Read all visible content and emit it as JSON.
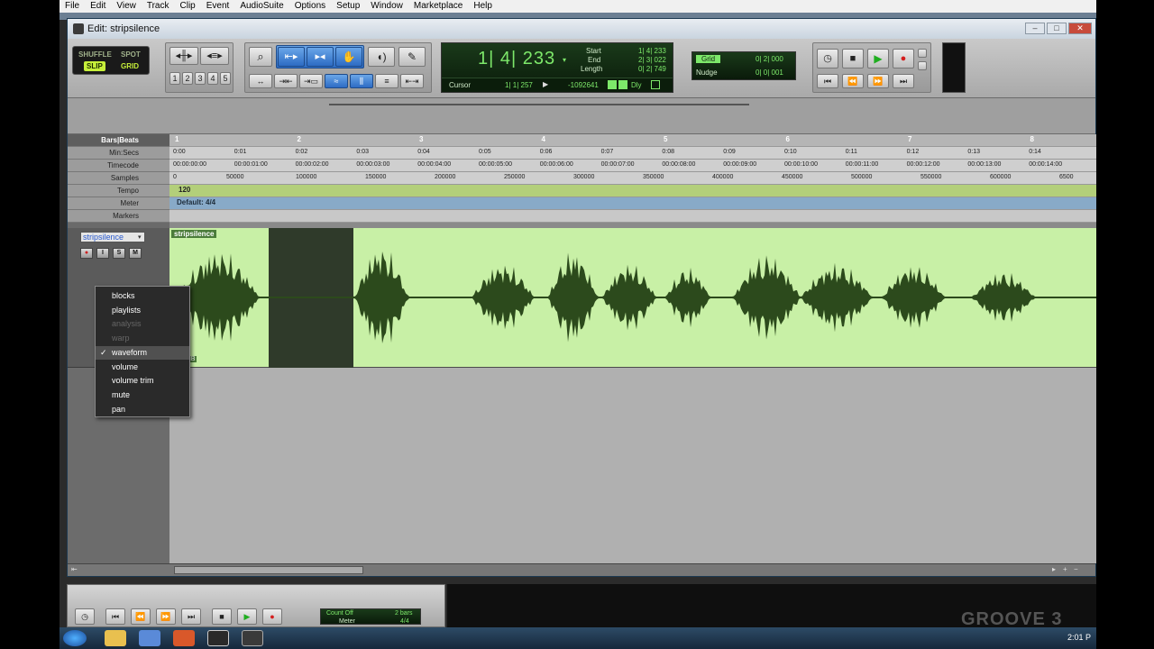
{
  "menu": [
    "File",
    "Edit",
    "View",
    "Track",
    "Clip",
    "Event",
    "AudioSuite",
    "Options",
    "Setup",
    "Window",
    "Marketplace",
    "Help"
  ],
  "window": {
    "title": "Edit: stripsilence"
  },
  "modes": {
    "shuffle": "SHUFFLE",
    "spot": "SPOT",
    "slip": "SLIP",
    "grid": "GRID"
  },
  "zoom_presets": [
    "1",
    "2",
    "3",
    "4",
    "5"
  ],
  "counter": {
    "main": "1| 4| 233",
    "start_label": "Start",
    "start": "1| 4| 233",
    "end_label": "End",
    "end": "2| 3| 022",
    "length_label": "Length",
    "length": "0| 2| 749",
    "cursor_label": "Cursor",
    "cursor": "1| 1| 257",
    "sample": "-1092641",
    "dly": "Dly"
  },
  "grid": {
    "label": "Grid",
    "value": "0| 2| 000",
    "nudge_label": "Nudge",
    "nudge": "0| 0| 001"
  },
  "rulers": {
    "labels": [
      "Bars|Beats",
      "Min:Secs",
      "Timecode",
      "Samples",
      "Tempo",
      "Meter",
      "Markers"
    ],
    "bars": [
      "1",
      "2",
      "3",
      "4",
      "5",
      "6",
      "7",
      "8"
    ],
    "minsecs": [
      "0:00",
      "0:01",
      "0:02",
      "0:03",
      "0:04",
      "0:05",
      "0:06",
      "0:07",
      "0:08",
      "0:09",
      "0:10",
      "0:11",
      "0:12",
      "0:13",
      "0:14"
    ],
    "timecode": [
      "00:00:00:00",
      "00:00:01:00",
      "00:00:02:00",
      "00:00:03:00",
      "00:00:04:00",
      "00:00:05:00",
      "00:00:06:00",
      "00:00:07:00",
      "00:00:08:00",
      "00:00:09:00",
      "00:00:10:00",
      "00:00:11:00",
      "00:00:12:00",
      "00:00:13:00",
      "00:00:14:00"
    ],
    "samples": [
      "0",
      "50000",
      "100000",
      "150000",
      "200000",
      "250000",
      "300000",
      "350000",
      "400000",
      "450000",
      "500000",
      "550000",
      "600000",
      "6500"
    ],
    "tempo_value": "120",
    "meter_value": "Default: 4/4"
  },
  "track": {
    "name": "stripsilence",
    "buttons": [
      "●",
      "I",
      "S",
      "M"
    ],
    "clip_name": "stripsilence",
    "clip_level": "0 dB"
  },
  "view_menu": {
    "items": [
      {
        "label": "blocks",
        "disabled": false,
        "checked": false
      },
      {
        "label": "playlists",
        "disabled": false,
        "checked": false
      },
      {
        "label": "analysis",
        "disabled": true,
        "checked": false
      },
      {
        "label": "warp",
        "disabled": true,
        "checked": false
      },
      {
        "label": "waveform",
        "disabled": false,
        "checked": true
      },
      {
        "label": "volume",
        "disabled": false,
        "checked": false
      },
      {
        "label": "volume trim",
        "disabled": false,
        "checked": false
      },
      {
        "label": "mute",
        "disabled": false,
        "checked": false
      },
      {
        "label": "pan",
        "disabled": false,
        "checked": false
      }
    ],
    "checkmark": "✓"
  },
  "transport_bottom": {
    "count_off": "Count Off",
    "bars": "2 bars",
    "meter": "Meter",
    "sig": "4/4"
  },
  "watermark": "GROOVE 3",
  "clock": "2:01 P",
  "colors": {
    "waveform": "#2c4a1c",
    "clip_bg": "#c8f0a6",
    "tempo_row": "#b3cf7a",
    "meter_row": "#88aac8"
  }
}
